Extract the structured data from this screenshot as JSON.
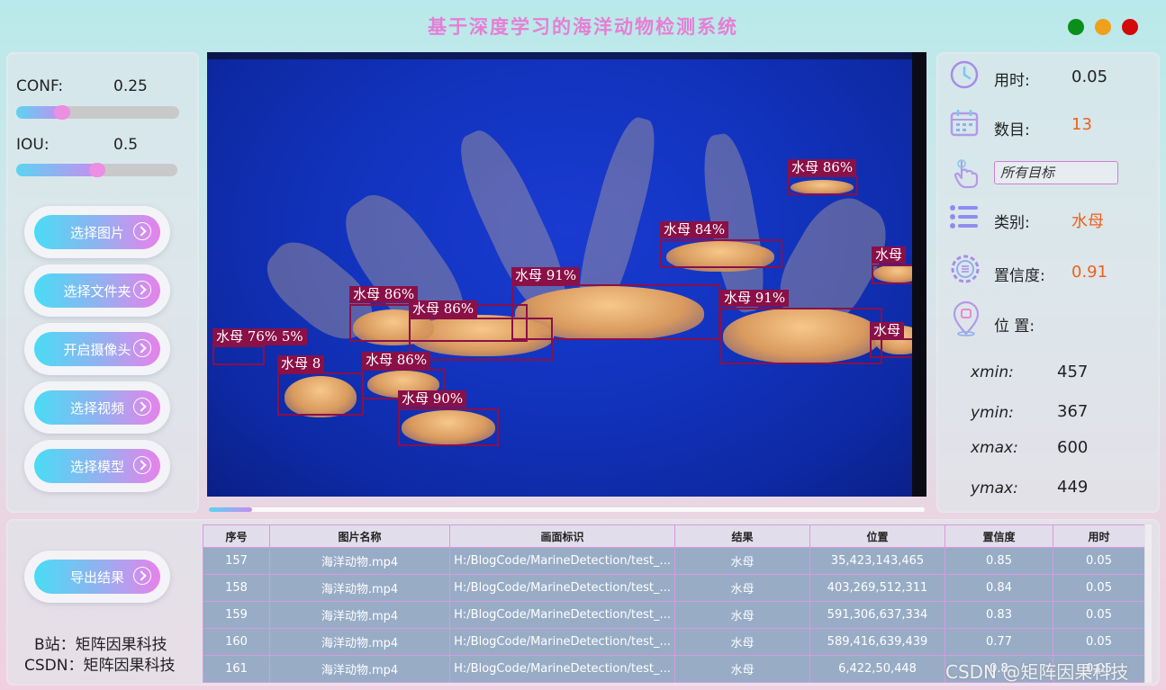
{
  "app": {
    "title": "基于深度学习的海洋动物检测系统",
    "window_controls": {
      "green": "#0a8f1a",
      "orange": "#f0a01a",
      "red": "#d30a0a"
    }
  },
  "params": {
    "conf_label": "CONF:",
    "conf_value": "0.25",
    "conf_fraction": 0.28,
    "iou_label": "IOU:",
    "iou_value": "0.5",
    "iou_fraction": 0.5
  },
  "buttons": {
    "select_image": "选择图片",
    "select_folder": "选择文件夹",
    "open_camera": "开启摄像头",
    "select_video": "选择视频",
    "select_model": "选择模型",
    "export": "导出结果"
  },
  "detections": [
    {
      "label": "水母 86%"
    },
    {
      "label": "水母 84%"
    },
    {
      "label": "水母 91%"
    },
    {
      "label": "水母 86%"
    },
    {
      "label": "水母 86%"
    },
    {
      "label": "水母 91%"
    },
    {
      "label": "水母 76% 5%"
    },
    {
      "label": "水母 8"
    },
    {
      "label": "水母 86%"
    },
    {
      "label": "水母 90%"
    },
    {
      "label": "水母"
    },
    {
      "label": "水母"
    }
  ],
  "video_progress": 0.06,
  "info": {
    "time_label": "用时:",
    "time_value": "0.05",
    "count_label": "数目:",
    "count_value": "13",
    "target_select": "所有目标",
    "class_label": "类别:",
    "class_value": "水母",
    "conf_label": "置信度:",
    "conf_value": "0.91",
    "position_label": "位 置:",
    "xmin_label": "xmin:",
    "xmin_value": "457",
    "ymin_label": "ymin:",
    "ymin_value": "367",
    "xmax_label": "xmax:",
    "xmax_value": "600",
    "ymax_label": "ymax:",
    "ymax_value": "449"
  },
  "table": {
    "headers": [
      "序号",
      "图片名称",
      "画面标识",
      "结果",
      "位置",
      "置信度",
      "用时"
    ],
    "rows": [
      [
        "157",
        "海洋动物.mp4",
        "H:/BlogCode/MarineDetection/test_...",
        "水母",
        "35,423,143,465",
        "0.85",
        "0.05"
      ],
      [
        "158",
        "海洋动物.mp4",
        "H:/BlogCode/MarineDetection/test_...",
        "水母",
        "403,269,512,311",
        "0.84",
        "0.05"
      ],
      [
        "159",
        "海洋动物.mp4",
        "H:/BlogCode/MarineDetection/test_...",
        "水母",
        "591,306,637,334",
        "0.83",
        "0.05"
      ],
      [
        "160",
        "海洋动物.mp4",
        "H:/BlogCode/MarineDetection/test_...",
        "水母",
        "589,416,639,439",
        "0.77",
        "0.05"
      ],
      [
        "161",
        "海洋动物.mp4",
        "H:/BlogCode/MarineDetection/test_...",
        "水母",
        "6,422,50,448",
        "0.8",
        "0.05"
      ]
    ]
  },
  "credits": {
    "bilibili": "B站：矩阵因果科技",
    "csdn": "CSDN：矩阵因果科技",
    "watermark": "CSDN @矩阵因果科技"
  }
}
